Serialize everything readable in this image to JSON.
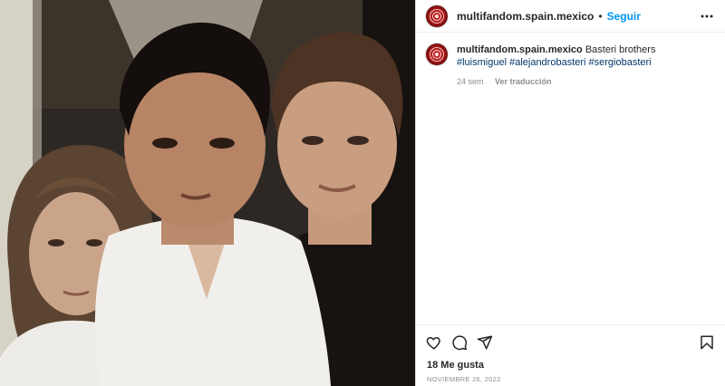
{
  "post": {
    "username": "multifandom.spain.mexico",
    "separator": "•",
    "follow_label": "Seguir",
    "more_icon": "more-horizontal-icon",
    "image_alt": "Foto de tres hermanos"
  },
  "caption": {
    "username": "multifandom.spain.mexico",
    "text": "Basteri brothers",
    "hashtags": "#luismiguel #alejandrobasteri #sergiobasteri",
    "age": "24 sem",
    "translate_label": "Ver traducción"
  },
  "actions": {
    "like_icon": "heart-icon",
    "comment_icon": "comment-icon",
    "share_icon": "share-icon",
    "save_icon": "bookmark-icon"
  },
  "stats": {
    "likes": "18 Me gusta",
    "date": "NOVIEMBRE 26, 2022"
  },
  "colors": {
    "accent": "#0095f6",
    "hashtag": "#00376b",
    "muted": "#8e8e8e"
  }
}
